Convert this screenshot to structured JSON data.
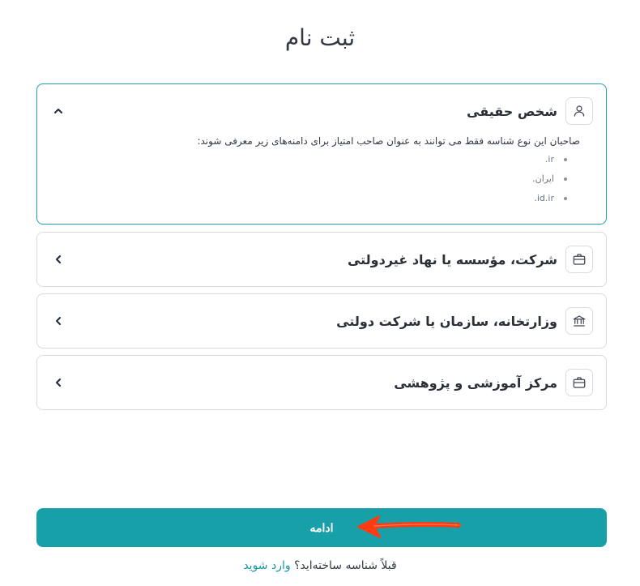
{
  "page": {
    "title": "ثبت نام"
  },
  "options": [
    {
      "title": "شخص حقیقی",
      "icon": "person-icon",
      "expanded": true,
      "description": "صاحبان این نوع شناسه فقط می توانند به عنوان صاحب امتیاز برای دامنه‌های زیر معرفی شوند:",
      "domains": [
        ".ir",
        ".ایران",
        ".id.ir"
      ]
    },
    {
      "title": "شرکت، مؤسسه یا نهاد غیردولتی",
      "icon": "briefcase-icon",
      "expanded": false
    },
    {
      "title": "وزارتخانه، سازمان یا شرکت دولتی",
      "icon": "bank-building-icon",
      "expanded": false
    },
    {
      "title": "مرکز آموزشی و پژوهشی",
      "icon": "briefcase-icon",
      "expanded": false
    }
  ],
  "actions": {
    "continue_label": "ادامه"
  },
  "footer": {
    "already_text": "قبلاً شناسه ساخته‌اید؟",
    "login_label": "وارد شوید"
  },
  "colors": {
    "accent": "#18a0a9",
    "arrow": "#ff3b12"
  }
}
